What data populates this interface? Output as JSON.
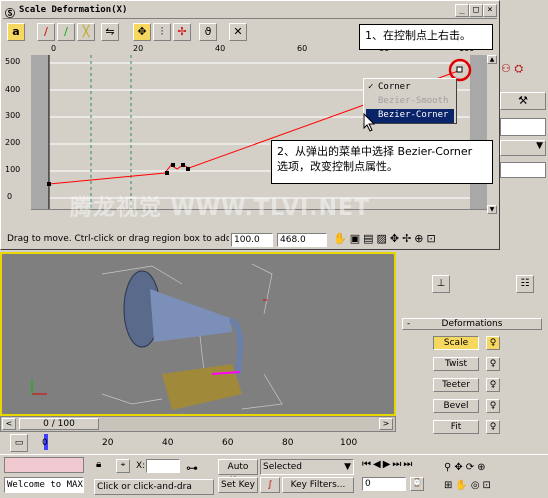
{
  "dialog": {
    "title": "Scale Deformation(X)",
    "title_buttons": [
      "_",
      "□",
      "×"
    ],
    "ruler_ticks": [
      "0",
      "20",
      "40",
      "60",
      "80",
      "100"
    ],
    "y_ticks": [
      "500",
      "400",
      "300",
      "200",
      "100",
      "0"
    ],
    "status_text": "Drag to move. Ctrl-click or drag region box to add to s",
    "x_value": "100.0",
    "y_value": "468.0"
  },
  "context_menu": {
    "items": [
      "Corner",
      "Bezier-Smooth",
      "Bezier-Corner"
    ],
    "checked": "Corner",
    "disabled": "Bezier-Smooth",
    "highlighted": "Bezier-Corner"
  },
  "callouts": {
    "step1": "1、在控制点上右击。",
    "step2_line1": "2、从弹出的菜单中选择 Bezier-Corner",
    "step2_line2": "选项，改变控制点属性。"
  },
  "watermark": "腾龙视觉 WWW.TLVI.NET",
  "viewport": {
    "frame_counter": "0 / 100",
    "track_ticks": [
      "0",
      "20",
      "40",
      "60",
      "80",
      "100"
    ]
  },
  "command_panel": {
    "rollout_title": "Deformations",
    "buttons": [
      "Scale",
      "Twist",
      "Teeter",
      "Bevel",
      "Fit"
    ]
  },
  "statusbar": {
    "script_text": "Welcome to MAX",
    "prompt_text": "Click or click-and-dra",
    "x_label": "X:",
    "auto_key": "Auto Key",
    "set_key": "Set Key",
    "selected": "Selected",
    "key_filters": "Key Filters...",
    "frame_field": "0"
  },
  "colors": {
    "curve": "#ff0000",
    "menu_highlight": "#0a246a",
    "viewport_border": "#e8d800",
    "highlight_circle": "#e00000"
  }
}
